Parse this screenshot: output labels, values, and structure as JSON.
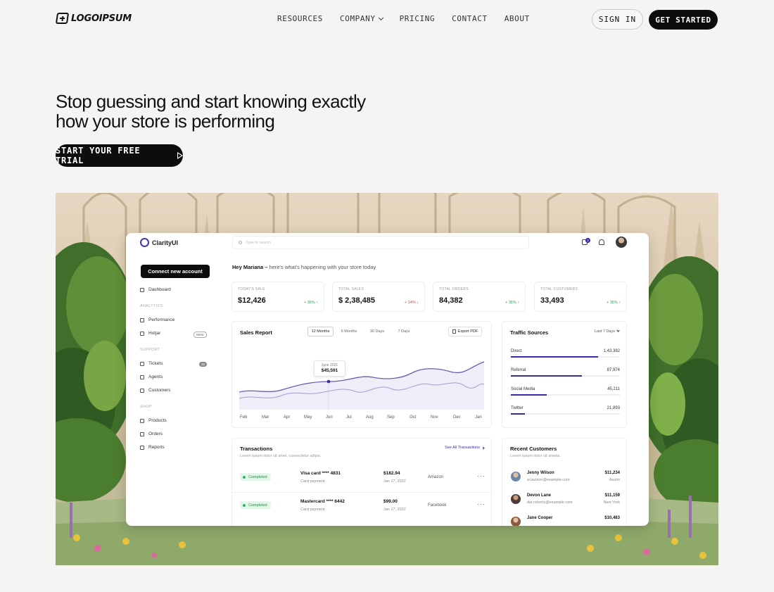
{
  "nav": {
    "logo_text": "LOGOIPSUM",
    "links": [
      "RESOURCES",
      "COMPANY",
      "PRICING",
      "CONTACT",
      "ABOUT"
    ],
    "sign_in": "SIGN IN",
    "get_started": "GET STARTED"
  },
  "hero": {
    "title_line1": "Stop guessing and start knowing exactly",
    "title_line2": "how your store is performing",
    "cta": "START YOUR FREE TRIAL"
  },
  "dashboard": {
    "brand": "ClarityUI",
    "search_placeholder": "Type to search",
    "notification_count": "2",
    "connect_button": "Connect new account",
    "greeting_name": "Hey Mariana –",
    "greeting_text": "here's what's happening with your store today",
    "sidebar": {
      "dashboard": "Dashboard",
      "analytics_heading": "ANALYTICS",
      "performance": "Performance",
      "hotjar": "Hotjar",
      "hotjar_badge": "NEW",
      "support_heading": "SUPPORT",
      "tickets": "Tickets",
      "tickets_badge": "15",
      "agents": "Agents",
      "customers": "Customers",
      "shop_heading": "SHOP",
      "products": "Products",
      "orders": "Orders",
      "reports": "Reports"
    },
    "stats": [
      {
        "label": "TODAY'S SALE",
        "value": "$12,426",
        "change": "+ 36% ↑",
        "trend": "up"
      },
      {
        "label": "TOTAL SALES",
        "value": "$ 2,38,485",
        "change": "+ 14% ↓",
        "trend": "down"
      },
      {
        "label": "TOTAL ORDERS",
        "value": "84,382",
        "change": "+ 36% ↑",
        "trend": "up"
      },
      {
        "label": "TOTAL CUSTOMERS",
        "value": "33,493",
        "change": "+ 36% ↑",
        "trend": "up"
      }
    ],
    "sales_report": {
      "title": "Sales Report",
      "ranges": [
        "12 Months",
        "6 Months",
        "30 Days",
        "7 Days"
      ],
      "selected_range": "12 Months",
      "export": "Export PDF",
      "tooltip_date": "June 2021",
      "tooltip_value": "$45,591",
      "months": [
        "Feb",
        "Mar",
        "Apr",
        "May",
        "Jun",
        "Jul",
        "Aug",
        "Sep",
        "Oct",
        "Nov",
        "Dec",
        "Jan"
      ]
    },
    "traffic": {
      "title": "Traffic Sources",
      "range": "Last 7 Days",
      "sources": [
        {
          "label": "Direct",
          "value": "1,43,382",
          "fraction": 0.8
        },
        {
          "label": "Referral",
          "value": "87,974",
          "fraction": 0.65
        },
        {
          "label": "Social Media",
          "value": "45,211",
          "fraction": 0.33
        },
        {
          "label": "Twitter",
          "value": "21,893",
          "fraction": 0.13
        }
      ]
    },
    "transactions": {
      "title": "Transactions",
      "subtitle": "Lorem ipsum dolor sit amet, consectetur adipis.",
      "see_all": "See All Transactions",
      "rows": [
        {
          "status": "Completed",
          "card": "Visa card **** 4831",
          "type": "Card payment",
          "amount": "$182.94",
          "date": "Jan 17, 2022",
          "vendor": "Amazon"
        },
        {
          "status": "Completed",
          "card": "Mastercard **** 6442",
          "type": "Card payment",
          "amount": "$99.00",
          "date": "Jan 17, 2022",
          "vendor": "Facebook"
        }
      ]
    },
    "customers": {
      "title": "Recent Customers",
      "subtitle": "Lorem ipsum dolor sit ametis.",
      "rows": [
        {
          "name": "Jenny Wilson",
          "email": "w.lawson@example.com",
          "amount": "$11,234",
          "city": "Austin"
        },
        {
          "name": "Devon Lane",
          "email": "dat.roberts@example.com",
          "amount": "$11,159",
          "city": "New York"
        },
        {
          "name": "Jane Cooper",
          "email": "",
          "amount": "$10,483",
          "city": ""
        }
      ]
    }
  },
  "colors": {
    "accent": "#3b2aa8",
    "page_bg": "#f6f4f2",
    "button_dark": "#0d0d0d",
    "positive": "#27a35a",
    "negative": "#d94040"
  }
}
